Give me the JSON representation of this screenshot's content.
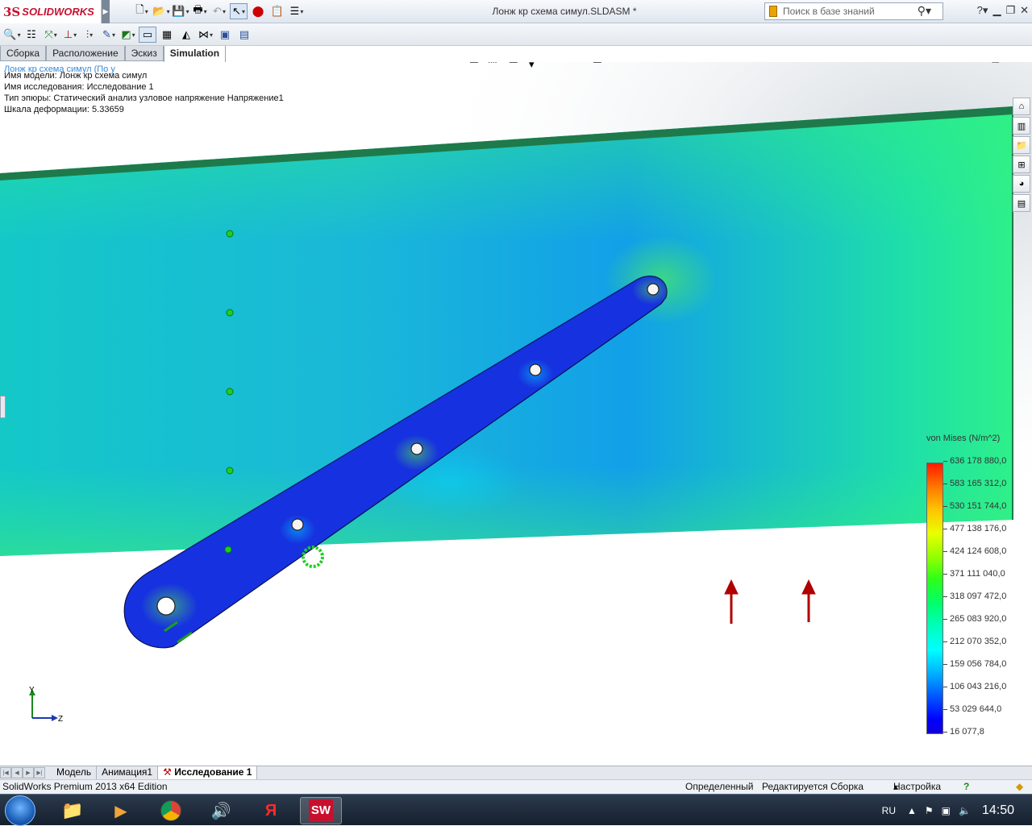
{
  "app": {
    "brand_ds": "3S",
    "brand_name": "SOLIDWORKS",
    "document_title": "Лонж кр схема симул.SLDASM *"
  },
  "search": {
    "placeholder": "Поиск в базе знаний"
  },
  "command_tabs": [
    {
      "label": "Сборка"
    },
    {
      "label": "Расположение"
    },
    {
      "label": "Эскиз"
    },
    {
      "label": "Simulation",
      "active": true
    }
  ],
  "tree_root": "Лонж кр схема симул (По у",
  "plot_info": {
    "model_name": "Имя модели: Лонж кр схема симул",
    "study_name": "Имя исследования: Исследование 1",
    "plot_type": "Тип эпюры: Статический анализ узловое напряжение Напряжение1",
    "deformation_scale": "Шкала деформации: 5.33659"
  },
  "legend": {
    "title": "von Mises (N/m^2)",
    "labels": [
      "636 178 880,0",
      "583 165 312,0",
      "530 151 744,0",
      "477 138 176,0",
      "424 124 608,0",
      "371 111 040,0",
      "318 097 472,0",
      "265 083 920,0",
      "212 070 352,0",
      "159 056 784,0",
      "106 043 216,0",
      "53 029 644,0",
      "16 077,8"
    ],
    "colors": {
      "max": "#ff1a00",
      "mid": "#00ff6e",
      "min": "#1200d8"
    }
  },
  "triad": {
    "y_label": "Y",
    "z_label": "Z"
  },
  "bottom_tabs": [
    {
      "label": "Модель"
    },
    {
      "label": "Анимация1"
    },
    {
      "label": "Исследование 1",
      "active": true
    }
  ],
  "status": {
    "edition": "SolidWorks Premium 2013 x64 Edition",
    "state": "Определенный",
    "editing": "Редактируется Сборка",
    "settings": "Настройка"
  },
  "taskbar": {
    "lang": "RU",
    "time": "14:50",
    "apps": [
      "explorer-icon",
      "media-player-icon",
      "chrome-icon",
      "audio-icon",
      "yandex-icon",
      "solidworks-icon"
    ]
  },
  "colors": {
    "accent": "#c8102e",
    "spar_edge": "#1e7a4a"
  }
}
